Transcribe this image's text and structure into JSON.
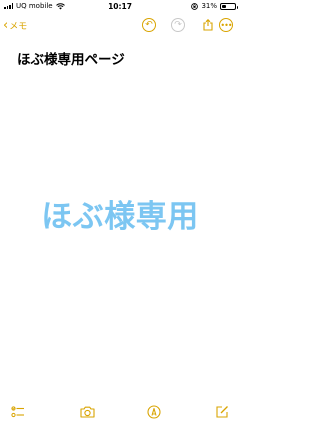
{
  "status_bar": {
    "carrier": "UQ mobile",
    "time": "10:17",
    "battery_percent": "31%",
    "battery_level": 0.31
  },
  "nav": {
    "back_label": "メモ",
    "accent_color": "#d9a400"
  },
  "note": {
    "title": "ほぶ様専用ページ",
    "body_text": "ほぶ様専用",
    "body_color": "#7cc6f2"
  },
  "toolbar": {
    "icons": [
      "checklist-icon",
      "camera-icon",
      "markup-pen-icon",
      "compose-icon"
    ]
  }
}
